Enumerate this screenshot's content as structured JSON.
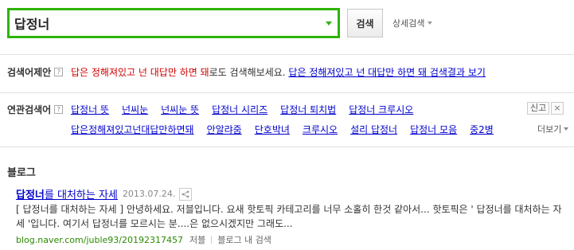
{
  "search": {
    "query": "답정너",
    "button_label": "검색",
    "advanced_label": "상세검색"
  },
  "suggestion": {
    "label": "검색어제안",
    "red_text": "답은 정해져있고 넌 대답만 하면 돼",
    "mid_text": "로도 검색해보세요.",
    "link_text": "답은 정해져있고 넌 대답만 하면 돼 검색결과 보기"
  },
  "related": {
    "label": "연관검색어",
    "row1": [
      "답정너 뜻",
      "넌씨눈",
      "넌씨눈 뜻",
      "답정너 시리즈",
      "답정너 퇴치법",
      "답정너 크루시오"
    ],
    "row2": [
      "답은정해져있고넌대답만하면돼",
      "안알랴줌",
      "단호박녀",
      "크루시오",
      "설리 답정너",
      "답정너 모음",
      "중2병"
    ],
    "report_label": "신고",
    "more_label": "더보기"
  },
  "blog": {
    "section_title": "블로그",
    "post": {
      "title_bold": "답정너",
      "title_rest": "를 대처하는 자세",
      "date": "2013.07.24.",
      "body": "[ 답정너를 대처하는 자세 ] 안녕하세요. 저블입니다. 요새 핫토픽 카테고리를 너무 소홀히 한것 같아서... 핫토픽은 ' 답정너를 대처하는 자세 '입니다. 여기서 답정너를 모르시는 분....은 없으시겠지만 그래도...",
      "url": "blog.naver.com/juble93/20192317457",
      "author": "저블",
      "blog_search": "블로그 내 검색"
    }
  },
  "colors": {
    "accent_green": "#2db400",
    "link_blue": "#0000cc",
    "suggest_red": "#d00000",
    "url_green": "#2a8a00"
  }
}
